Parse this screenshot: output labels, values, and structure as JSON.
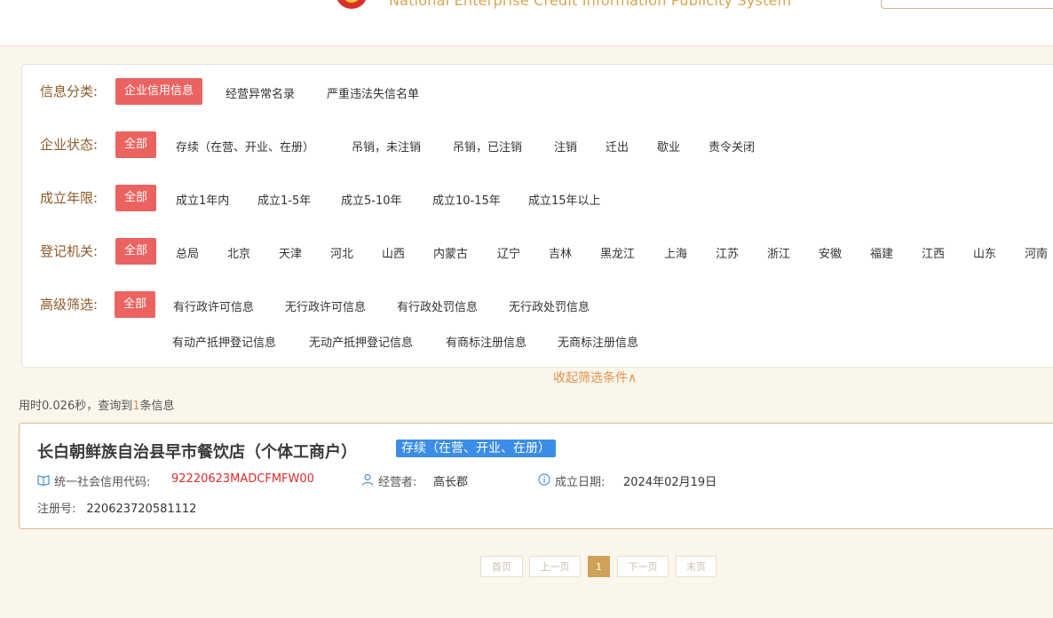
{
  "header": {
    "system_title": "National Enterprise Credit Information Publicity System"
  },
  "filters": {
    "info_category": {
      "label": "信息分类:",
      "options": [
        "企业信用信息",
        "经营异常名录",
        "严重违法失信名单"
      ]
    },
    "status": {
      "label": "企业状态:",
      "options": [
        "全部",
        "存续（在营、开业、在册）",
        "吊销，未注销",
        "吊销，已注销",
        "注销",
        "迁出",
        "歇业",
        "责令关闭"
      ]
    },
    "established": {
      "label": "成立年限:",
      "options": [
        "全部",
        "成立1年内",
        "成立1-5年",
        "成立5-10年",
        "成立10-15年",
        "成立15年以上"
      ]
    },
    "authority": {
      "label": "登记机关:",
      "options": [
        "全部",
        "总局",
        "北京",
        "天津",
        "河北",
        "山西",
        "内蒙古",
        "辽宁",
        "吉林",
        "黑龙江",
        "上海",
        "江苏",
        "浙江",
        "安徽",
        "福建",
        "江西",
        "山东",
        "河南"
      ]
    },
    "advanced": {
      "label": "高级筛选:",
      "options": [
        "全部",
        "有行政许可信息",
        "无行政许可信息",
        "有行政处罚信息",
        "无行政处罚信息",
        "有动产抵押登记信息",
        "无动产抵押登记信息",
        "有商标注册信息",
        "无商标注册信息"
      ]
    },
    "collapse_label": "收起筛选条件∧"
  },
  "summary": {
    "prefix": "用时0.026秒，查询到",
    "count": "1",
    "suffix": "条信息"
  },
  "result": {
    "company_name": "长白朝鲜族自治县早市餐饮店（个体工商户）",
    "status": "存续（在营、开业、在册）",
    "credit_code_label": "统一社会信用代码:",
    "credit_code": "92220623MADCFMFW00",
    "operator_label": "经营者:",
    "operator": "高长郡",
    "founded_label": "成立日期:",
    "founded": "2024年02月19日",
    "reg_no_label": "注册号:",
    "reg_no": "220623720581112"
  },
  "pagination": {
    "first": "首页",
    "prev": "上一页",
    "current": "1",
    "next": "下一页",
    "last": "末页"
  },
  "colors": {
    "accent": "#eb6360",
    "label": "#8c5a2a",
    "status_badge": "#3b8de8",
    "credit_code": "#e12b2b",
    "pager_current": "#cfa25a"
  },
  "icons": {
    "credit_code": "book-icon",
    "operator": "user-icon",
    "founded": "info-icon"
  }
}
